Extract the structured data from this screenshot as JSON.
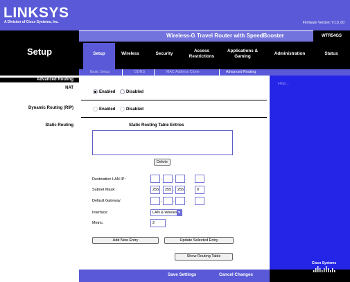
{
  "brand": {
    "logo": "LINKSYS",
    "tagline": "A Division of Cisco Systems, Inc.",
    "firmware": "Firmware Version: V1.0_00"
  },
  "product": {
    "name": "Wireless-G Travel Router with SpeedBooster",
    "model": "WTR54GS"
  },
  "page_title": "Setup",
  "nav": {
    "tabs": [
      {
        "label": "Setup"
      },
      {
        "label": "Wireless"
      },
      {
        "label": "Security"
      },
      {
        "label": "Access Restrictions"
      },
      {
        "label": "Applications & Gaming"
      },
      {
        "label": "Administration"
      },
      {
        "label": "Status"
      }
    ],
    "subtabs": [
      "Basic Setup",
      "DDNS",
      "MAC Address Clone",
      "Advanced Routing"
    ]
  },
  "sections": {
    "advanced_routing": "Advanced Routing",
    "nat": "NAT",
    "dynamic_routing": "Dynamic Routing (RIP)",
    "static_routing": "Static Routing"
  },
  "nat": {
    "enabled": "Enabled",
    "disabled": "Disabled",
    "selected": "enabled"
  },
  "rip": {
    "enabled": "Enabled",
    "disabled": "Disabled"
  },
  "static": {
    "table_title": "Static Routing Table Entries",
    "delete": "Delete",
    "dest_label": "Destination LAN IP:",
    "mask_label": "Subnet Mask:",
    "gateway_label": "Default Gateway:",
    "interface_label": "Interface:",
    "metric_label": "Metric:",
    "subnet": [
      "255",
      "255",
      "255",
      "0"
    ],
    "interface_value": "LAN & Wireless",
    "metric_value": "2",
    "add_entry": "Add New Entry",
    "update_entry": "Update Selected Entry",
    "show_table": "Show Routing Table"
  },
  "help": {
    "label": "Help..."
  },
  "footer": {
    "save": "Save Settings",
    "cancel": "Cancel Changes"
  },
  "cisco_logo": "Cisco Systems",
  "colors": {
    "accent": "#5a5ad8",
    "help_panel": "#2525e8",
    "header_black": "#000000"
  }
}
